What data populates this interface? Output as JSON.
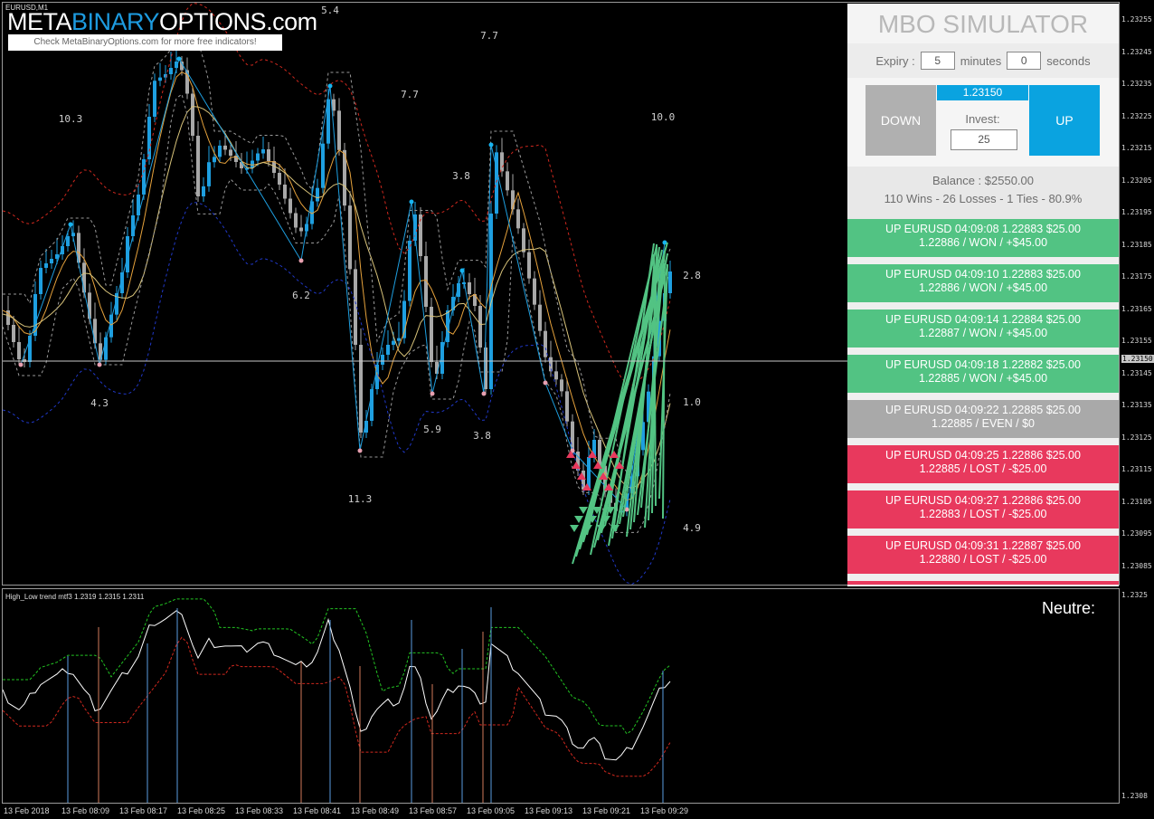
{
  "chart": {
    "symbol": "EURUSD,M1",
    "indicator_label": "High_Low trend mtf3  1.2319 1.2315 1.2311",
    "neutre_label": "Neutre:",
    "current_price_tag": "1.23150",
    "price_ticks": [
      "1.23255",
      "1.23245",
      "1.23235",
      "1.23225",
      "1.23215",
      "1.23205",
      "1.23195",
      "1.23185",
      "1.23175",
      "1.23165",
      "1.23155",
      "1.23145",
      "1.23135",
      "1.23125",
      "1.23115",
      "1.23105",
      "1.23095",
      "1.23085"
    ],
    "sub_ticks": [
      "1.2325",
      "1.2308"
    ],
    "time_ticks": [
      "13 Feb 2018",
      "13 Feb 08:09",
      "13 Feb 08:17",
      "13 Feb 08:25",
      "13 Feb 08:33",
      "13 Feb 08:41",
      "13 Feb 08:49",
      "13 Feb 08:57",
      "13 Feb 09:05",
      "13 Feb 09:13",
      "13 Feb 09:21",
      "13 Feb 09:29"
    ],
    "zigzag_labels": [
      "5.4",
      "7.7",
      "10.3",
      "7.7",
      "10.0",
      "3.8",
      "2.8",
      "6.2",
      "4.3",
      "1.0",
      "5.9",
      "3.8",
      "11.3",
      "4.9"
    ]
  },
  "logo": {
    "part1": "META",
    "part2": "BINARY",
    "part3": "OPTIONS",
    "part4": ".com",
    "tagline": "Check MetaBinaryOptions.com for more free indicators!"
  },
  "simulator": {
    "title": "MBO SIMULATOR",
    "expiry_label": "Expiry :",
    "expiry_minutes": "5",
    "minutes_label": "minutes",
    "expiry_seconds": "0",
    "seconds_label": "seconds",
    "down_label": "DOWN",
    "up_label": "UP",
    "current_price": "1.23150",
    "invest_label": "Invest:",
    "invest_value": "25",
    "balance": "Balance : $2550.00",
    "record": "110 Wins - 26 Losses - 1 Ties - 80.9%",
    "trades": [
      {
        "line1": "UP EURUSD 04:09:08 1.22883 $25.00",
        "line2": "1.22886 / WON / +$45.00",
        "status": "won"
      },
      {
        "line1": "UP EURUSD 04:09:10 1.22883 $25.00",
        "line2": "1.22886 / WON / +$45.00",
        "status": "won"
      },
      {
        "line1": "UP EURUSD 04:09:14 1.22884 $25.00",
        "line2": "1.22887 / WON / +$45.00",
        "status": "won"
      },
      {
        "line1": "UP EURUSD 04:09:18 1.22882 $25.00",
        "line2": "1.22885 / WON / +$45.00",
        "status": "won"
      },
      {
        "line1": "UP EURUSD 04:09:22 1.22885 $25.00",
        "line2": "1.22885 / EVEN / $0",
        "status": "even"
      },
      {
        "line1": "UP EURUSD 04:09:25 1.22886 $25.00",
        "line2": "1.22885 / LOST / -$25.00",
        "status": "lost"
      },
      {
        "line1": "UP EURUSD 04:09:27 1.22886 $25.00",
        "line2": "1.22883 / LOST / -$25.00",
        "status": "lost"
      },
      {
        "line1": "UP EURUSD 04:09:31 1.22887 $25.00",
        "line2": "1.22880 / LOST / -$25.00",
        "status": "lost"
      }
    ]
  },
  "colors": {
    "up_candle": "#1e9fe0",
    "down_candle": "#a8a8a8",
    "won": "#52c383",
    "lost": "#e8395d",
    "even": "#a9a9a9",
    "accent": "#0aa3e0"
  }
}
